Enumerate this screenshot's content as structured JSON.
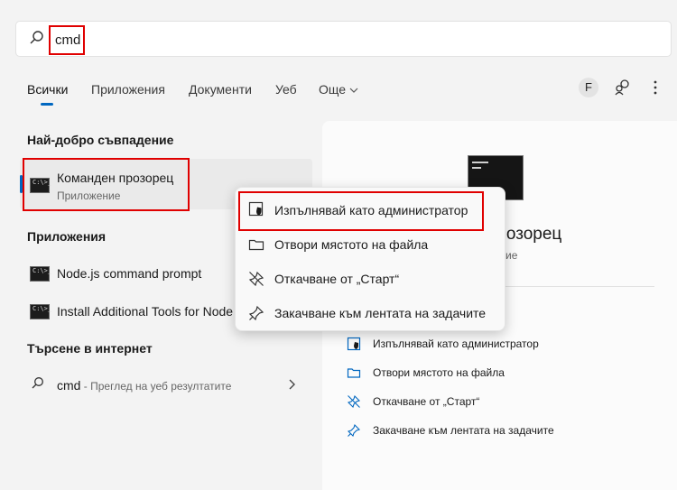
{
  "search": {
    "query": "cmd"
  },
  "tabs": [
    {
      "label": "Всички"
    },
    {
      "label": "Приложения"
    },
    {
      "label": "Документи"
    },
    {
      "label": "Уеб"
    },
    {
      "label": "Още"
    }
  ],
  "header": {
    "avatar_initial": "F"
  },
  "best_match": {
    "heading": "Най-добро съвпадение",
    "title": "Команден прозорец",
    "subtitle": "Приложение"
  },
  "apps": {
    "heading": "Приложения",
    "items": [
      {
        "label": "Node.js command prompt"
      },
      {
        "label": "Install Additional Tools for Node"
      }
    ]
  },
  "web": {
    "heading": "Търсене в интернет",
    "query": "cmd",
    "hint": " - Преглед на уеб резултатите"
  },
  "panel": {
    "title": "прозорец",
    "subtitle": "ие",
    "actions": [
      {
        "label": "Изпълнявай като администратор",
        "icon": "shield-icon"
      },
      {
        "label": "Отвори мястото на файла",
        "icon": "folder-icon"
      },
      {
        "label": "Откачване от „Старт“",
        "icon": "unpin-icon"
      },
      {
        "label": "Закачване към лентата на задачите",
        "icon": "pin-icon"
      }
    ]
  },
  "context_menu": {
    "items": [
      {
        "label": "Изпълнявай като администратор",
        "icon": "shield-icon"
      },
      {
        "label": "Отвори мястото на файла",
        "icon": "folder-icon"
      },
      {
        "label": "Откачване от „Старт“",
        "icon": "unpin-icon"
      },
      {
        "label": "Закачване към лентата на задачите",
        "icon": "pin-icon"
      }
    ]
  },
  "colors": {
    "accent": "#0067c0",
    "highlight_border": "#e00000"
  }
}
